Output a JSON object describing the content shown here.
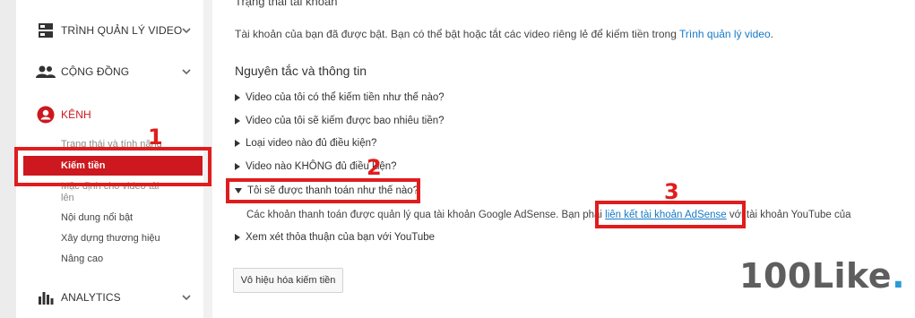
{
  "sidebar": {
    "sections": [
      {
        "label": "TRÌNH QUẢN LÝ VIDEO",
        "icon": "video-manager-icon"
      },
      {
        "label": "CỘNG ĐỒNG",
        "icon": "community-icon"
      },
      {
        "label": "KÊNH",
        "icon": "channel-icon"
      },
      {
        "label": "ANALYTICS",
        "icon": "analytics-icon"
      }
    ],
    "channel_items": [
      "Trạng thái và tính năng",
      "Kiếm tiền",
      "Mặc định cho video tải",
      "lên",
      "Nội dung nổi bật",
      "Xây dựng thương hiệu",
      "Nâng cao"
    ]
  },
  "main": {
    "account_status_title": "Trạng thái tài khoản",
    "status_text": "Tài khoản của bạn đã được bật. Bạn có thể bật hoặc tắt các video riêng lẻ để kiếm tiền trong ",
    "status_link": "Trình quản lý video",
    "status_suffix": ".",
    "section_title": "Nguyên tắc và thông tin",
    "faq": [
      "Video của tôi có thể kiếm tiền như thế nào?",
      "Video của tôi sẽ kiếm được bao nhiêu tiền?",
      "Loại video nào đủ điều kiện?",
      "Video nào KHÔNG đủ điều kiện?",
      "Tôi sẽ được thanh toán như thế nào?",
      "Xem xét thỏa thuận của bạn với YouTube"
    ],
    "answer_prefix": "Các khoản thanh toán được quản lý qua tài khoản Google AdSense. Bạn phải ",
    "answer_link": "liên kết tài khoản AdSense",
    "answer_suffix": " với tài khoản YouTube của",
    "disable_button": "Vô hiệu hóa kiếm tiền"
  },
  "annotations": {
    "n1": "1",
    "n2": "2",
    "n3": "3"
  },
  "watermark": {
    "text": "100Like",
    "dot": "."
  },
  "colors": {
    "accent_red": "#cc181e",
    "annotation_red": "#e01d1d",
    "link_blue": "#167ac6"
  }
}
